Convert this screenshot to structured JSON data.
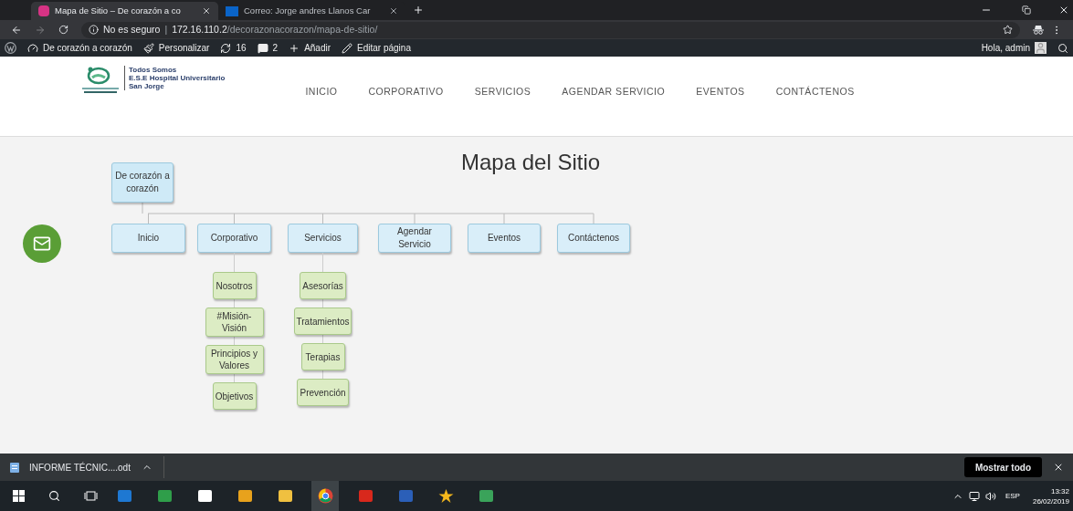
{
  "browser": {
    "tabs": [
      {
        "title": "Mapa de Sitio – De corazón a co",
        "selected": true,
        "kind": "site"
      },
      {
        "title": "Correo: Jorge andres Llanos Car",
        "selected": false,
        "kind": "mail"
      }
    ],
    "address": {
      "security": "No es seguro",
      "separator": "|",
      "host": "172.16.110.2",
      "path": "/decorazonacorazon/mapa-de-sitio/"
    }
  },
  "admin_bar": {
    "items": [
      {
        "kind": "site",
        "label": "De corazón a corazón"
      },
      {
        "kind": "customize",
        "label": "Personalizar"
      },
      {
        "kind": "updates",
        "label": "16"
      },
      {
        "kind": "comments",
        "label": "2"
      },
      {
        "kind": "new",
        "label": "Añadir"
      },
      {
        "kind": "edit",
        "label": "Editar página"
      }
    ],
    "greeting": "Hola, admin"
  },
  "site_header": {
    "logo_lines": [
      "Todos Somos",
      "E.S.E Hospital Universitario",
      "San Jorge"
    ],
    "nav": [
      "INICIO",
      "CORPORATIVO",
      "SERVICIOS",
      "AGENDAR SERVICIO",
      "EVENTOS",
      "CONTÁCTENOS"
    ]
  },
  "page_title": "Mapa del Sitio",
  "sitemap": {
    "label": "De corazón a corazón",
    "children": [
      {
        "label": "Inicio"
      },
      {
        "label": "Corporativo",
        "children": [
          {
            "label": "Nosotros"
          },
          {
            "label": "#Misión-Visión"
          },
          {
            "label": "Principios y Valores"
          },
          {
            "label": "Objetivos"
          }
        ]
      },
      {
        "label": "Servicios",
        "children": [
          {
            "label": "Asesorías"
          },
          {
            "label": "Tratamientos"
          },
          {
            "label": "Terapias"
          },
          {
            "label": "Prevención"
          }
        ]
      },
      {
        "label": "Agendar Servicio"
      },
      {
        "label": "Eventos"
      },
      {
        "label": "Contáctenos"
      }
    ]
  },
  "download_bar": {
    "file": "INFORME TÉCNIC....odt",
    "button": "Mostrar todo"
  },
  "taskbar": {
    "language": "ESP",
    "time": "13:32",
    "date": "26/02/2019"
  }
}
